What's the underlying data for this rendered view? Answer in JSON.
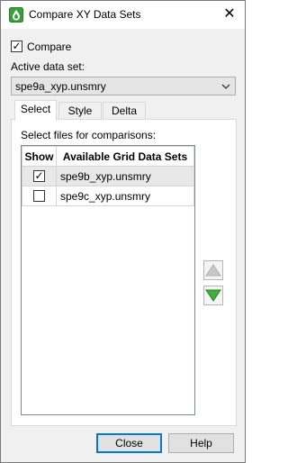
{
  "window": {
    "title": "Compare XY Data Sets",
    "close_glyph": "✕"
  },
  "compare": {
    "label": "Compare",
    "checked": true
  },
  "active_data_set": {
    "label": "Active data set:",
    "value": "spe9a_xyp.unsmry"
  },
  "tabs": [
    {
      "label": "Select",
      "active": true
    },
    {
      "label": "Style",
      "active": false
    },
    {
      "label": "Delta",
      "active": false
    }
  ],
  "select_tab": {
    "instruction": "Select files for comparisons:",
    "columns": [
      "Show",
      "Available Grid Data Sets"
    ],
    "rows": [
      {
        "show": true,
        "name": "spe9b_xyp.unsmry",
        "selected": true
      },
      {
        "show": false,
        "name": "spe9c_xyp.unsmry",
        "selected": false
      }
    ]
  },
  "icons": {
    "app": "drop-icon",
    "move_up": "triangle-up-icon",
    "move_down": "triangle-down-icon",
    "close": "close-icon",
    "dropdown": "chevron-down-icon"
  },
  "colors": {
    "accent_green": "#3a9e3a",
    "focus_blue": "#0078d7"
  },
  "buttons": {
    "close": "Close",
    "help": "Help"
  }
}
